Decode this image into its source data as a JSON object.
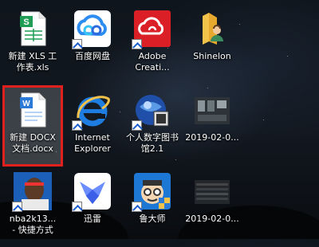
{
  "desktop_icons": [
    {
      "name": "xls-file",
      "line1": "新建 XLS 工",
      "line2": "作表.xls"
    },
    {
      "name": "baidu-netdisk",
      "line1": "百度网盘",
      "line2": ""
    },
    {
      "name": "adobe-cc",
      "line1": "Adobe",
      "line2": "Creati..."
    },
    {
      "name": "shinelon-user",
      "line1": "Shinelon",
      "line2": ""
    },
    {
      "name": "docx-file",
      "line1": "新建 DOCX",
      "line2": "文档.docx"
    },
    {
      "name": "internet-explorer",
      "line1": "Internet",
      "line2": "Explorer"
    },
    {
      "name": "digital-library",
      "line1": "个人数字图书",
      "line2": "馆2.1"
    },
    {
      "name": "video-2019-1",
      "line1": "2019-02-0...",
      "line2": ""
    },
    {
      "name": "nba2k13",
      "line1": "nba2k13...",
      "line2": "- 快捷方式"
    },
    {
      "name": "xunlei",
      "line1": "迅雷",
      "line2": ""
    },
    {
      "name": "ludashi",
      "line1": "鲁大师",
      "line2": ""
    },
    {
      "name": "video-2019-2",
      "line1": "2019-02-0...",
      "line2": ""
    }
  ],
  "colors": {
    "selection_outline": "#e0201c",
    "xls_green": "#1f9d55",
    "docx_blue": "#2b7bd6",
    "adobe_red": "#da1f26",
    "folder_yellow": "#f2c24a",
    "ie_blue": "#1e7de0",
    "xunlei_blue": "#6a8cff"
  }
}
